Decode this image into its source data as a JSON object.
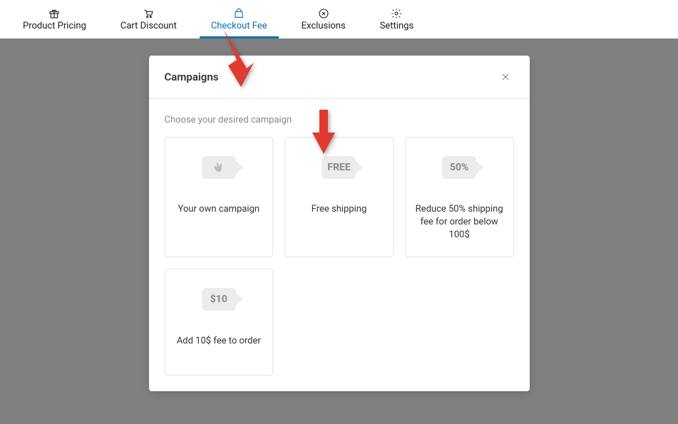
{
  "tabs": [
    {
      "label": "Product Pricing"
    },
    {
      "label": "Cart Discount"
    },
    {
      "label": "Checkout Fee"
    },
    {
      "label": "Exclusions"
    },
    {
      "label": "Settings"
    }
  ],
  "modal": {
    "title": "Campaigns",
    "subtitle": "Choose your desired campaign",
    "campaigns": [
      {
        "badge": "",
        "label": "Your own campaign"
      },
      {
        "badge": "FREE",
        "label": "Free shipping"
      },
      {
        "badge": "50%",
        "label": "Reduce 50% shipping fee for order below 100$"
      },
      {
        "badge": "$10",
        "label": "Add 10$ fee to order"
      }
    ]
  }
}
